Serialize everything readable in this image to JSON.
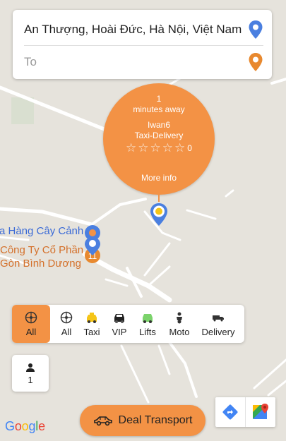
{
  "route": {
    "from_value": "An Thượng, Hoài Đức, Hà Nội, Việt Nam",
    "to_placeholder": "To"
  },
  "driver_bubble": {
    "eta_number": "1",
    "eta_unit": "minutes away",
    "driver_name": "Iwan6",
    "service": "Taxi-Delivery",
    "rating_stars": 0,
    "rating_count": "0",
    "more_info": "More info"
  },
  "map_labels": {
    "poi_1": "a Hàng Cây Cảnh",
    "poi_2": "Công Ty Cổ Phần",
    "poi_3": "Gòn Bình Dương"
  },
  "vehicle_filters": [
    {
      "label": "All",
      "icon": "wheel-icon",
      "active": true
    },
    {
      "label": "All",
      "icon": "wheel-icon",
      "active": false
    },
    {
      "label": "Taxi",
      "icon": "taxi-car-icon",
      "active": false
    },
    {
      "label": "VIP",
      "icon": "vip-car-icon",
      "active": false
    },
    {
      "label": "Lifts",
      "icon": "lift-car-icon",
      "active": false
    },
    {
      "label": "Moto",
      "icon": "motorbike-icon",
      "active": false
    },
    {
      "label": "Delivery",
      "icon": "truck-icon",
      "active": false
    }
  ],
  "passengers": {
    "count": "1",
    "icon": "person-icon"
  },
  "deal_button": {
    "label": "Deal Transport",
    "icon": "car-outline-icon"
  },
  "map_controls": {
    "directions_icon": "directions-icon",
    "maps_icon": "google-maps-icon"
  },
  "attribution": {
    "logo_text": "Google"
  },
  "colors": {
    "accent": "#f39245",
    "pin_blue": "#4a7fe0",
    "pin_orange": "#e8892f",
    "taxi_yellow": "#f5c518",
    "lift_green": "#7bd36b"
  }
}
